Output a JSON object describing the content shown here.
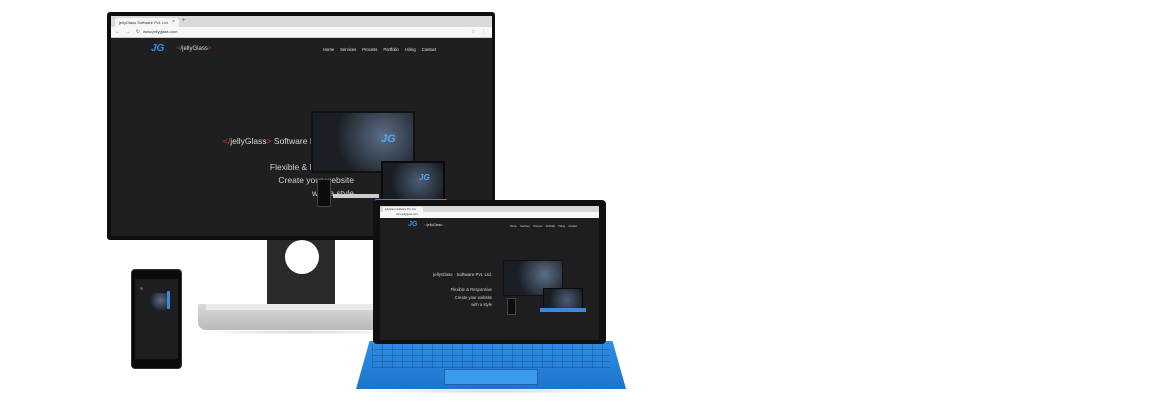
{
  "browser": {
    "tab_title": "jellyGlass Software Pvt. Ltd.",
    "tab_close": "×",
    "new_tab": "+",
    "nav_icons": "← → ↻",
    "url": "www.jellyglass.com",
    "right_icons": "☆ ⋮"
  },
  "site": {
    "logo_mark": "JG",
    "logo_text_open": "<",
    "logo_text_name": "/jellyGlass",
    "logo_text_close": ">",
    "nav": [
      "Home",
      "Services",
      "Process",
      "Portfolio",
      "Hiring",
      "Contact"
    ],
    "hero_bracket_open": "</",
    "hero_name": "jellyGlass",
    "hero_bracket_close": ">",
    "hero_suffix": " Software Pvt. Ltd.",
    "tagline_lines": [
      "Flexible & Responsive",
      "Create your website",
      "with a style"
    ]
  },
  "tablet": {
    "tab_title": "jellyGlass Software Pvt. Ltd.",
    "url": "www.jellyglass.com",
    "brand_full": "jellyGlass · Software Pvt. Ltd.",
    "tagline_lines": [
      "Flexible & Responsive",
      "Create your website",
      "with a style"
    ]
  },
  "colors": {
    "accent_blue": "#3a8ee6",
    "bracket_red": "#d23a2e",
    "site_bg": "#1f1f21",
    "keyboard_blue": "#1e74cc"
  }
}
